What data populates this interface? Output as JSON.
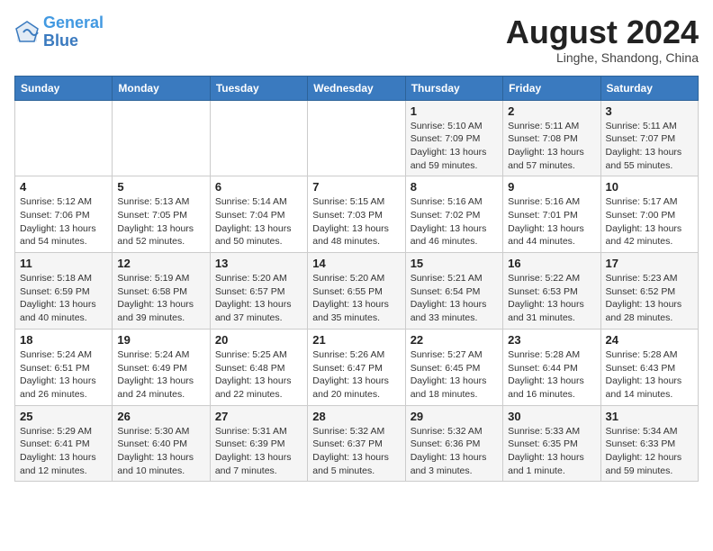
{
  "header": {
    "logo_line1": "General",
    "logo_line2": "Blue",
    "month": "August 2024",
    "location": "Linghe, Shandong, China"
  },
  "weekdays": [
    "Sunday",
    "Monday",
    "Tuesday",
    "Wednesday",
    "Thursday",
    "Friday",
    "Saturday"
  ],
  "weeks": [
    [
      {
        "day": "",
        "info": ""
      },
      {
        "day": "",
        "info": ""
      },
      {
        "day": "",
        "info": ""
      },
      {
        "day": "",
        "info": ""
      },
      {
        "day": "1",
        "info": "Sunrise: 5:10 AM\nSunset: 7:09 PM\nDaylight: 13 hours\nand 59 minutes."
      },
      {
        "day": "2",
        "info": "Sunrise: 5:11 AM\nSunset: 7:08 PM\nDaylight: 13 hours\nand 57 minutes."
      },
      {
        "day": "3",
        "info": "Sunrise: 5:11 AM\nSunset: 7:07 PM\nDaylight: 13 hours\nand 55 minutes."
      }
    ],
    [
      {
        "day": "4",
        "info": "Sunrise: 5:12 AM\nSunset: 7:06 PM\nDaylight: 13 hours\nand 54 minutes."
      },
      {
        "day": "5",
        "info": "Sunrise: 5:13 AM\nSunset: 7:05 PM\nDaylight: 13 hours\nand 52 minutes."
      },
      {
        "day": "6",
        "info": "Sunrise: 5:14 AM\nSunset: 7:04 PM\nDaylight: 13 hours\nand 50 minutes."
      },
      {
        "day": "7",
        "info": "Sunrise: 5:15 AM\nSunset: 7:03 PM\nDaylight: 13 hours\nand 48 minutes."
      },
      {
        "day": "8",
        "info": "Sunrise: 5:16 AM\nSunset: 7:02 PM\nDaylight: 13 hours\nand 46 minutes."
      },
      {
        "day": "9",
        "info": "Sunrise: 5:16 AM\nSunset: 7:01 PM\nDaylight: 13 hours\nand 44 minutes."
      },
      {
        "day": "10",
        "info": "Sunrise: 5:17 AM\nSunset: 7:00 PM\nDaylight: 13 hours\nand 42 minutes."
      }
    ],
    [
      {
        "day": "11",
        "info": "Sunrise: 5:18 AM\nSunset: 6:59 PM\nDaylight: 13 hours\nand 40 minutes."
      },
      {
        "day": "12",
        "info": "Sunrise: 5:19 AM\nSunset: 6:58 PM\nDaylight: 13 hours\nand 39 minutes."
      },
      {
        "day": "13",
        "info": "Sunrise: 5:20 AM\nSunset: 6:57 PM\nDaylight: 13 hours\nand 37 minutes."
      },
      {
        "day": "14",
        "info": "Sunrise: 5:20 AM\nSunset: 6:55 PM\nDaylight: 13 hours\nand 35 minutes."
      },
      {
        "day": "15",
        "info": "Sunrise: 5:21 AM\nSunset: 6:54 PM\nDaylight: 13 hours\nand 33 minutes."
      },
      {
        "day": "16",
        "info": "Sunrise: 5:22 AM\nSunset: 6:53 PM\nDaylight: 13 hours\nand 31 minutes."
      },
      {
        "day": "17",
        "info": "Sunrise: 5:23 AM\nSunset: 6:52 PM\nDaylight: 13 hours\nand 28 minutes."
      }
    ],
    [
      {
        "day": "18",
        "info": "Sunrise: 5:24 AM\nSunset: 6:51 PM\nDaylight: 13 hours\nand 26 minutes."
      },
      {
        "day": "19",
        "info": "Sunrise: 5:24 AM\nSunset: 6:49 PM\nDaylight: 13 hours\nand 24 minutes."
      },
      {
        "day": "20",
        "info": "Sunrise: 5:25 AM\nSunset: 6:48 PM\nDaylight: 13 hours\nand 22 minutes."
      },
      {
        "day": "21",
        "info": "Sunrise: 5:26 AM\nSunset: 6:47 PM\nDaylight: 13 hours\nand 20 minutes."
      },
      {
        "day": "22",
        "info": "Sunrise: 5:27 AM\nSunset: 6:45 PM\nDaylight: 13 hours\nand 18 minutes."
      },
      {
        "day": "23",
        "info": "Sunrise: 5:28 AM\nSunset: 6:44 PM\nDaylight: 13 hours\nand 16 minutes."
      },
      {
        "day": "24",
        "info": "Sunrise: 5:28 AM\nSunset: 6:43 PM\nDaylight: 13 hours\nand 14 minutes."
      }
    ],
    [
      {
        "day": "25",
        "info": "Sunrise: 5:29 AM\nSunset: 6:41 PM\nDaylight: 13 hours\nand 12 minutes."
      },
      {
        "day": "26",
        "info": "Sunrise: 5:30 AM\nSunset: 6:40 PM\nDaylight: 13 hours\nand 10 minutes."
      },
      {
        "day": "27",
        "info": "Sunrise: 5:31 AM\nSunset: 6:39 PM\nDaylight: 13 hours\nand 7 minutes."
      },
      {
        "day": "28",
        "info": "Sunrise: 5:32 AM\nSunset: 6:37 PM\nDaylight: 13 hours\nand 5 minutes."
      },
      {
        "day": "29",
        "info": "Sunrise: 5:32 AM\nSunset: 6:36 PM\nDaylight: 13 hours\nand 3 minutes."
      },
      {
        "day": "30",
        "info": "Sunrise: 5:33 AM\nSunset: 6:35 PM\nDaylight: 13 hours\nand 1 minute."
      },
      {
        "day": "31",
        "info": "Sunrise: 5:34 AM\nSunset: 6:33 PM\nDaylight: 12 hours\nand 59 minutes."
      }
    ]
  ]
}
